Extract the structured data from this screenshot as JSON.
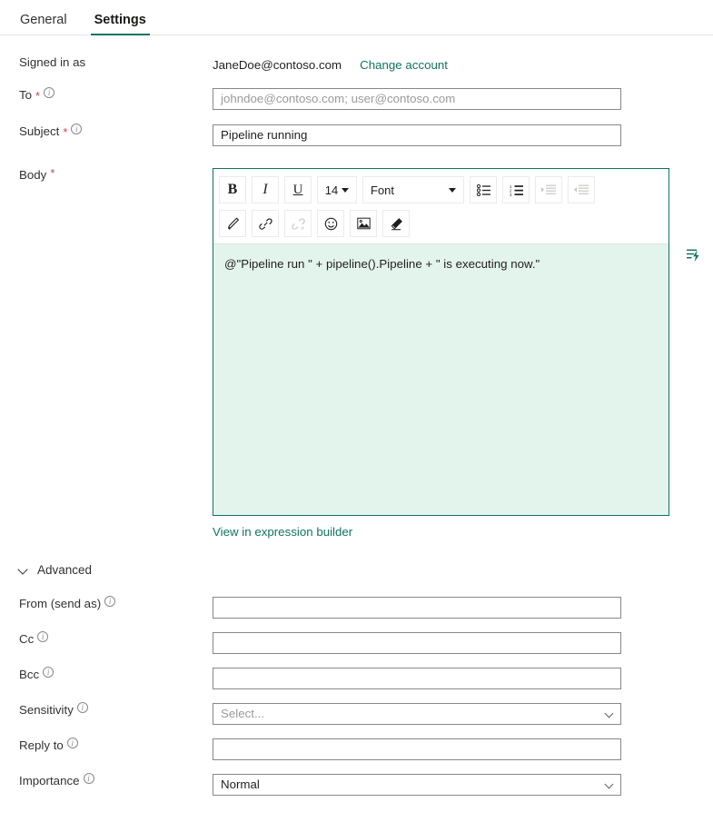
{
  "tabs": [
    {
      "label": "General",
      "active": false
    },
    {
      "label": "Settings",
      "active": true
    }
  ],
  "accent_color": "#107361",
  "fields": {
    "signed_in_label": "Signed in as",
    "signed_in_value": "JaneDoe@contoso.com",
    "change_account_link": "Change account",
    "to_label": "To",
    "to_placeholder": "johndoe@contoso.com; user@contoso.com",
    "to_value": "",
    "subject_label": "Subject",
    "subject_value": "Pipeline running",
    "body_label": "Body",
    "body_value": "@\"Pipeline run \" + pipeline().Pipeline + \" is executing now.\"",
    "expression_builder_link": "View in expression builder"
  },
  "toolbar": {
    "bold": "B",
    "italic": "I",
    "underline": "U",
    "font_size": "14",
    "font_name": "Font",
    "icons": {
      "bulleted_list": "bulleted-list-icon",
      "numbered_list": "numbered-list-icon",
      "decrease_indent": "decrease-indent-icon",
      "increase_indent": "increase-indent-icon",
      "highlighter": "highlighter-pen-icon",
      "link": "link-icon",
      "unlink": "unlink-icon",
      "emoji": "emoji-icon",
      "image": "image-icon",
      "clear_format": "eraser-icon",
      "dynamic_content": "dynamic-content-lightning-icon"
    }
  },
  "advanced": {
    "label": "Advanced",
    "expanded": true,
    "rows": [
      {
        "label": "From (send as)",
        "value": "",
        "placeholder": "",
        "type": "text"
      },
      {
        "label": "Cc",
        "value": "",
        "placeholder": "",
        "type": "text"
      },
      {
        "label": "Bcc",
        "value": "",
        "placeholder": "",
        "type": "text"
      },
      {
        "label": "Sensitivity",
        "value": "Select...",
        "placeholder": "Select...",
        "type": "select"
      },
      {
        "label": "Reply to",
        "value": "",
        "placeholder": "",
        "type": "text"
      },
      {
        "label": "Importance",
        "value": "Normal",
        "placeholder": "",
        "type": "select"
      }
    ]
  }
}
